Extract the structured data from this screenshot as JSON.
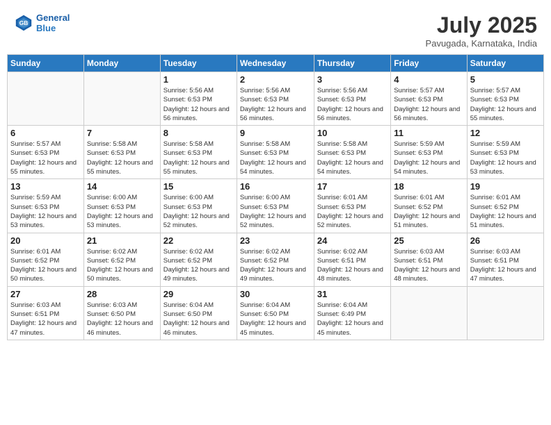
{
  "header": {
    "logo_line1": "General",
    "logo_line2": "Blue",
    "month_year": "July 2025",
    "location": "Pavugada, Karnataka, India"
  },
  "weekdays": [
    "Sunday",
    "Monday",
    "Tuesday",
    "Wednesday",
    "Thursday",
    "Friday",
    "Saturday"
  ],
  "weeks": [
    [
      {
        "day": "",
        "info": ""
      },
      {
        "day": "",
        "info": ""
      },
      {
        "day": "1",
        "info": "Sunrise: 5:56 AM\nSunset: 6:53 PM\nDaylight: 12 hours and 56 minutes."
      },
      {
        "day": "2",
        "info": "Sunrise: 5:56 AM\nSunset: 6:53 PM\nDaylight: 12 hours and 56 minutes."
      },
      {
        "day": "3",
        "info": "Sunrise: 5:56 AM\nSunset: 6:53 PM\nDaylight: 12 hours and 56 minutes."
      },
      {
        "day": "4",
        "info": "Sunrise: 5:57 AM\nSunset: 6:53 PM\nDaylight: 12 hours and 56 minutes."
      },
      {
        "day": "5",
        "info": "Sunrise: 5:57 AM\nSunset: 6:53 PM\nDaylight: 12 hours and 55 minutes."
      }
    ],
    [
      {
        "day": "6",
        "info": "Sunrise: 5:57 AM\nSunset: 6:53 PM\nDaylight: 12 hours and 55 minutes."
      },
      {
        "day": "7",
        "info": "Sunrise: 5:58 AM\nSunset: 6:53 PM\nDaylight: 12 hours and 55 minutes."
      },
      {
        "day": "8",
        "info": "Sunrise: 5:58 AM\nSunset: 6:53 PM\nDaylight: 12 hours and 55 minutes."
      },
      {
        "day": "9",
        "info": "Sunrise: 5:58 AM\nSunset: 6:53 PM\nDaylight: 12 hours and 54 minutes."
      },
      {
        "day": "10",
        "info": "Sunrise: 5:58 AM\nSunset: 6:53 PM\nDaylight: 12 hours and 54 minutes."
      },
      {
        "day": "11",
        "info": "Sunrise: 5:59 AM\nSunset: 6:53 PM\nDaylight: 12 hours and 54 minutes."
      },
      {
        "day": "12",
        "info": "Sunrise: 5:59 AM\nSunset: 6:53 PM\nDaylight: 12 hours and 53 minutes."
      }
    ],
    [
      {
        "day": "13",
        "info": "Sunrise: 5:59 AM\nSunset: 6:53 PM\nDaylight: 12 hours and 53 minutes."
      },
      {
        "day": "14",
        "info": "Sunrise: 6:00 AM\nSunset: 6:53 PM\nDaylight: 12 hours and 53 minutes."
      },
      {
        "day": "15",
        "info": "Sunrise: 6:00 AM\nSunset: 6:53 PM\nDaylight: 12 hours and 52 minutes."
      },
      {
        "day": "16",
        "info": "Sunrise: 6:00 AM\nSunset: 6:53 PM\nDaylight: 12 hours and 52 minutes."
      },
      {
        "day": "17",
        "info": "Sunrise: 6:01 AM\nSunset: 6:53 PM\nDaylight: 12 hours and 52 minutes."
      },
      {
        "day": "18",
        "info": "Sunrise: 6:01 AM\nSunset: 6:52 PM\nDaylight: 12 hours and 51 minutes."
      },
      {
        "day": "19",
        "info": "Sunrise: 6:01 AM\nSunset: 6:52 PM\nDaylight: 12 hours and 51 minutes."
      }
    ],
    [
      {
        "day": "20",
        "info": "Sunrise: 6:01 AM\nSunset: 6:52 PM\nDaylight: 12 hours and 50 minutes."
      },
      {
        "day": "21",
        "info": "Sunrise: 6:02 AM\nSunset: 6:52 PM\nDaylight: 12 hours and 50 minutes."
      },
      {
        "day": "22",
        "info": "Sunrise: 6:02 AM\nSunset: 6:52 PM\nDaylight: 12 hours and 49 minutes."
      },
      {
        "day": "23",
        "info": "Sunrise: 6:02 AM\nSunset: 6:52 PM\nDaylight: 12 hours and 49 minutes."
      },
      {
        "day": "24",
        "info": "Sunrise: 6:02 AM\nSunset: 6:51 PM\nDaylight: 12 hours and 48 minutes."
      },
      {
        "day": "25",
        "info": "Sunrise: 6:03 AM\nSunset: 6:51 PM\nDaylight: 12 hours and 48 minutes."
      },
      {
        "day": "26",
        "info": "Sunrise: 6:03 AM\nSunset: 6:51 PM\nDaylight: 12 hours and 47 minutes."
      }
    ],
    [
      {
        "day": "27",
        "info": "Sunrise: 6:03 AM\nSunset: 6:51 PM\nDaylight: 12 hours and 47 minutes."
      },
      {
        "day": "28",
        "info": "Sunrise: 6:03 AM\nSunset: 6:50 PM\nDaylight: 12 hours and 46 minutes."
      },
      {
        "day": "29",
        "info": "Sunrise: 6:04 AM\nSunset: 6:50 PM\nDaylight: 12 hours and 46 minutes."
      },
      {
        "day": "30",
        "info": "Sunrise: 6:04 AM\nSunset: 6:50 PM\nDaylight: 12 hours and 45 minutes."
      },
      {
        "day": "31",
        "info": "Sunrise: 6:04 AM\nSunset: 6:49 PM\nDaylight: 12 hours and 45 minutes."
      },
      {
        "day": "",
        "info": ""
      },
      {
        "day": "",
        "info": ""
      }
    ]
  ]
}
